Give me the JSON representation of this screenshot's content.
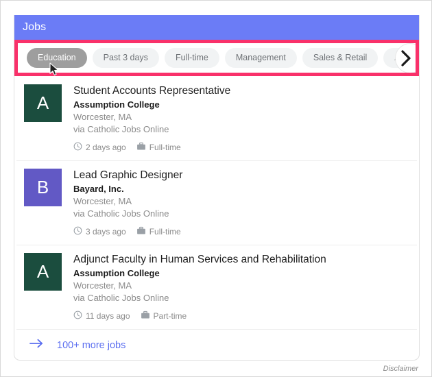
{
  "window": {
    "frame_border_color": "#d8d8d8"
  },
  "header": {
    "title": "Jobs",
    "background_color": "#6b7cf6",
    "text_color": "#ffffff"
  },
  "filters": {
    "highlight_color": "#f9316a",
    "selected_chip_color": "#9e9e9e",
    "chip_color": "#f1f3f4",
    "next_icon": "chevron-right-icon",
    "chips": [
      {
        "label": "Education",
        "selected": true
      },
      {
        "label": "Past 3 days",
        "selected": false
      },
      {
        "label": "Full-time",
        "selected": false
      },
      {
        "label": "Management",
        "selected": false
      },
      {
        "label": "Sales & Retail",
        "selected": false
      },
      {
        "label": "Advertising & Marketing",
        "selected": false
      }
    ]
  },
  "jobs": [
    {
      "logo_letter": "A",
      "logo_color": "#1b4d3e",
      "title": "Student Accounts Representative",
      "company": "Assumption College",
      "location": "Worcester, MA",
      "source": "via Catholic Jobs Online",
      "posted": "2 days ago",
      "posted_icon": "clock-icon",
      "employment_type": "Full-time",
      "employment_icon": "briefcase-icon"
    },
    {
      "logo_letter": "B",
      "logo_color": "#6259c5",
      "title": "Lead Graphic Designer",
      "company": "Bayard, Inc.",
      "location": "Worcester, MA",
      "source": "via Catholic Jobs Online",
      "posted": "3 days ago",
      "posted_icon": "clock-icon",
      "employment_type": "Full-time",
      "employment_icon": "briefcase-icon"
    },
    {
      "logo_letter": "A",
      "logo_color": "#1b4d3e",
      "title": "Adjunct Faculty in Human Services and Rehabilitation",
      "company": "Assumption College",
      "location": "Worcester, MA",
      "source": "via Catholic Jobs Online",
      "posted": "11 days ago",
      "posted_icon": "clock-icon",
      "employment_type": "Part-time",
      "employment_icon": "briefcase-icon"
    }
  ],
  "footer": {
    "more_jobs_label": "100+ more jobs",
    "more_jobs_icon": "arrow-right-icon",
    "link_color": "#5b6ef0"
  },
  "disclaimer": {
    "label": "Disclaimer"
  }
}
